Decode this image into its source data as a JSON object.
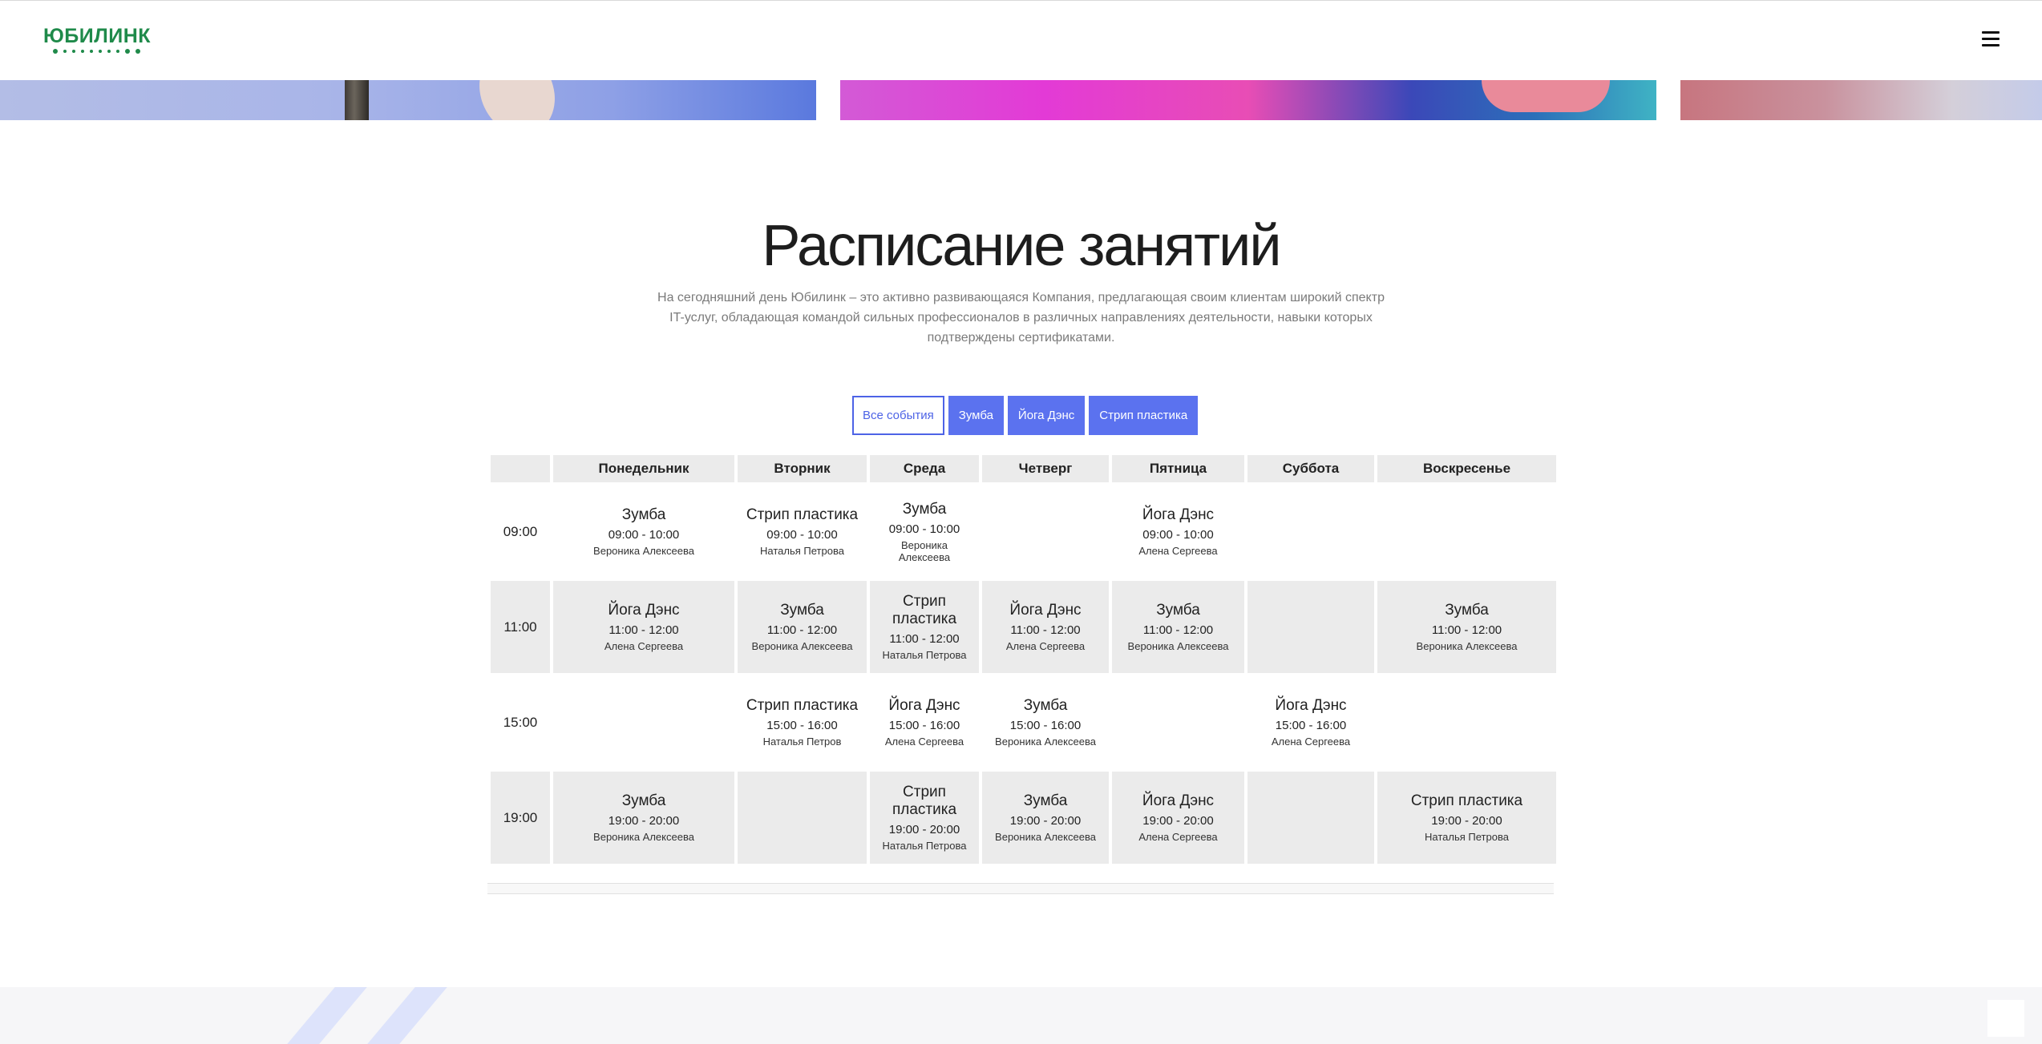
{
  "header": {
    "logo_text": "ЮБИЛИНК",
    "menu_icon": "hamburger-menu-icon",
    "brand_color": "#1f8a4a"
  },
  "section": {
    "title": "Расписание занятий",
    "description": "На сегодняшний день Юбилинк – это активно развивающаяся Компания, предлагающая своим клиентам широкий спектр IT-услуг, обладающая командой сильных профессионалов в различных направлениях деятельности, навыки которых подтверждены сертификатами."
  },
  "filters": [
    {
      "label": "Все события",
      "active": true
    },
    {
      "label": "Зумба",
      "active": false
    },
    {
      "label": "Йога Дэнс",
      "active": false
    },
    {
      "label": "Стрип пластика",
      "active": false
    }
  ],
  "accent_color": "#5b72ef",
  "schedule": {
    "days": [
      "Понедельник",
      "Вторник",
      "Среда",
      "Четверг",
      "Пятница",
      "Суббота",
      "Воскресенье"
    ],
    "rows": [
      {
        "time": "09:00",
        "cells": [
          {
            "title": "Зумба",
            "time": "09:00 - 10:00",
            "trainer": "Вероника Алексеева"
          },
          {
            "title": "Стрип пластика",
            "time": "09:00 - 10:00",
            "trainer": "Наталья Петрова"
          },
          {
            "title": "Зумба",
            "time": "09:00 - 10:00",
            "trainer": "Вероника Алексеева"
          },
          null,
          {
            "title": "Йога Дэнс",
            "time": "09:00 - 10:00",
            "trainer": "Алена Сергеева"
          },
          null,
          null
        ]
      },
      {
        "time": "11:00",
        "cells": [
          {
            "title": "Йога Дэнс",
            "time": "11:00 - 12:00",
            "trainer": "Алена Сергеева"
          },
          {
            "title": "Зумба",
            "time": "11:00 - 12:00",
            "trainer": "Вероника Алексеева"
          },
          {
            "title": "Стрип пластика",
            "time": "11:00 - 12:00",
            "trainer": "Наталья Петрова"
          },
          {
            "title": "Йога Дэнс",
            "time": "11:00 - 12:00",
            "trainer": "Алена Сергеева"
          },
          {
            "title": "Зумба",
            "time": "11:00 - 12:00",
            "trainer": "Вероника Алексеева"
          },
          null,
          {
            "title": "Зумба",
            "time": "11:00 - 12:00",
            "trainer": "Вероника Алексеева"
          }
        ]
      },
      {
        "time": "15:00",
        "cells": [
          null,
          {
            "title": "Стрип пластика",
            "time": "15:00 - 16:00",
            "trainer": "Наталья Петров"
          },
          {
            "title": "Йога Дэнс",
            "time": "15:00 - 16:00",
            "trainer": "Алена Сергеева"
          },
          {
            "title": "Зумба",
            "time": "15:00 - 16:00",
            "trainer": "Вероника Алексеева"
          },
          null,
          {
            "title": "Йога Дэнс",
            "time": "15:00 - 16:00",
            "trainer": "Алена Сергеева"
          },
          null
        ]
      },
      {
        "time": "19:00",
        "cells": [
          {
            "title": "Зумба",
            "time": "19:00 - 20:00",
            "trainer": "Вероника Алексеева"
          },
          null,
          {
            "title": "Стрип пластика",
            "time": "19:00 - 20:00",
            "trainer": "Наталья Петрова"
          },
          {
            "title": "Зумба",
            "time": "19:00 - 20:00",
            "trainer": "Вероника Алексеева"
          },
          {
            "title": "Йога Дэнс",
            "time": "19:00 - 20:00",
            "trainer": "Алена Сергеева"
          },
          null,
          {
            "title": "Стрип пластика",
            "time": "19:00 - 20:00",
            "trainer": "Наталья Петрова"
          }
        ]
      }
    ]
  }
}
